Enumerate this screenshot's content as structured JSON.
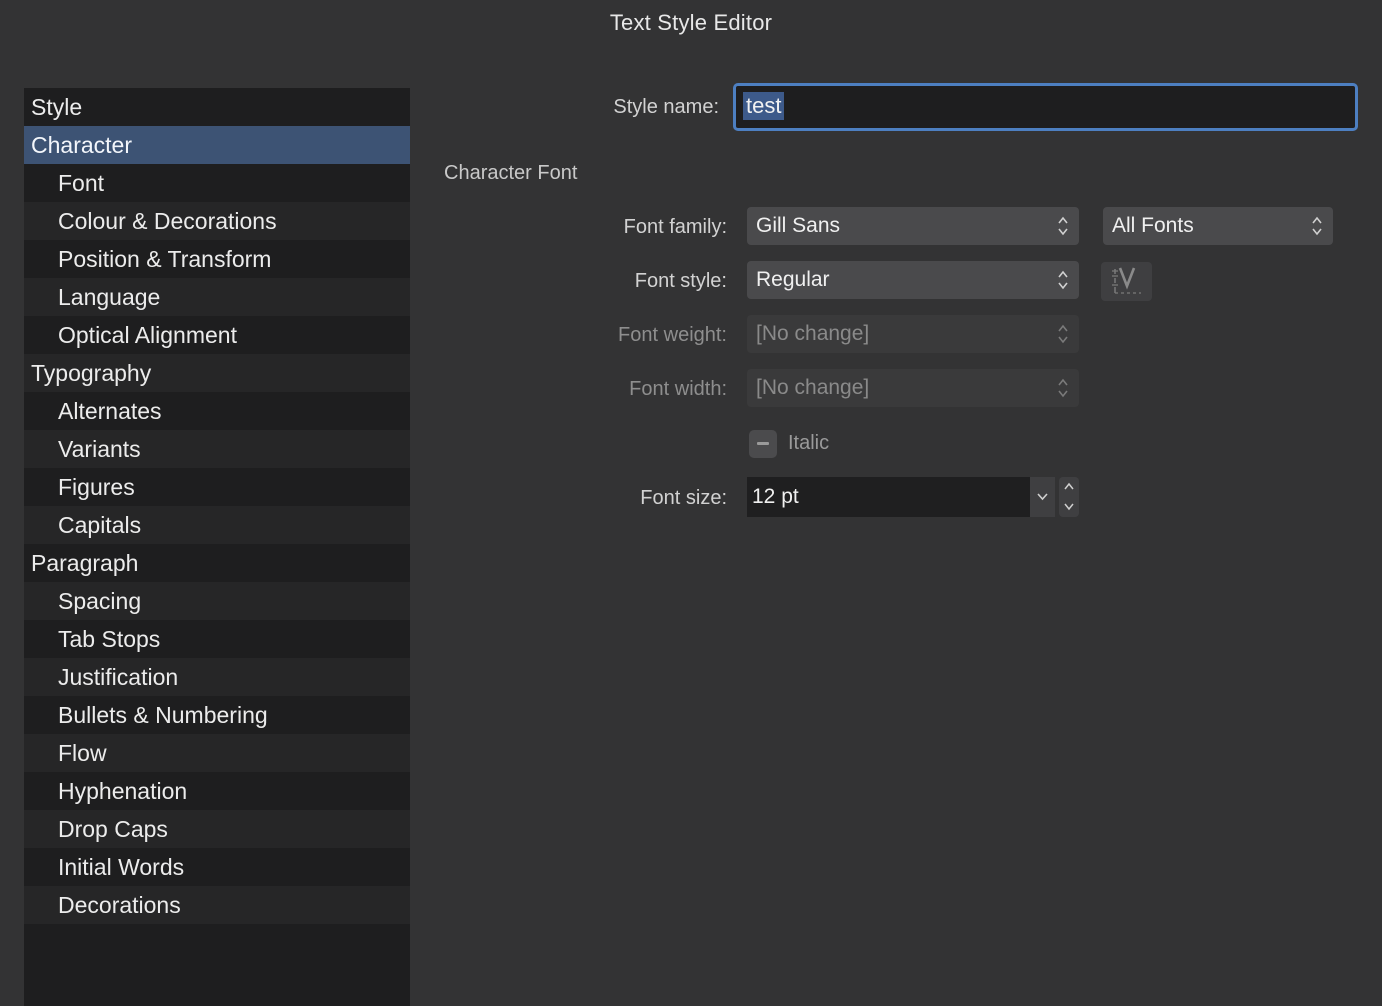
{
  "window": {
    "title": "Text Style Editor"
  },
  "sidebar": {
    "items": [
      {
        "label": "Style",
        "level": 0
      },
      {
        "label": "Character",
        "level": 0,
        "selected": true
      },
      {
        "label": "Font",
        "level": 1
      },
      {
        "label": "Colour & Decorations",
        "level": 1
      },
      {
        "label": "Position & Transform",
        "level": 1
      },
      {
        "label": "Language",
        "level": 1
      },
      {
        "label": "Optical Alignment",
        "level": 1
      },
      {
        "label": "Typography",
        "level": 0
      },
      {
        "label": "Alternates",
        "level": 1
      },
      {
        "label": "Variants",
        "level": 1
      },
      {
        "label": "Figures",
        "level": 1
      },
      {
        "label": "Capitals",
        "level": 1
      },
      {
        "label": "Paragraph",
        "level": 0
      },
      {
        "label": "Spacing",
        "level": 1
      },
      {
        "label": "Tab Stops",
        "level": 1
      },
      {
        "label": "Justification",
        "level": 1
      },
      {
        "label": "Bullets & Numbering",
        "level": 1
      },
      {
        "label": "Flow",
        "level": 1
      },
      {
        "label": "Hyphenation",
        "level": 1
      },
      {
        "label": "Drop Caps",
        "level": 1
      },
      {
        "label": "Initial Words",
        "level": 1
      },
      {
        "label": "Decorations",
        "level": 1
      }
    ]
  },
  "form": {
    "style_name_label": "Style name:",
    "style_name_value": "test",
    "section_title": "Character Font",
    "font_family_label": "Font family:",
    "font_family_value": "Gill Sans",
    "font_collection_value": "All Fonts",
    "font_style_label": "Font style:",
    "font_style_value": "Regular",
    "font_weight_label": "Font weight:",
    "font_weight_value": "[No change]",
    "font_width_label": "Font width:",
    "font_width_value": "[No change]",
    "italic_label": "Italic",
    "font_size_label": "Font size:",
    "font_size_value": "12 pt"
  },
  "colors": {
    "background": "#333334",
    "sidebar": "#1e1e1f",
    "selection": "#3d5374",
    "focus_ring": "#4d7fc1"
  }
}
